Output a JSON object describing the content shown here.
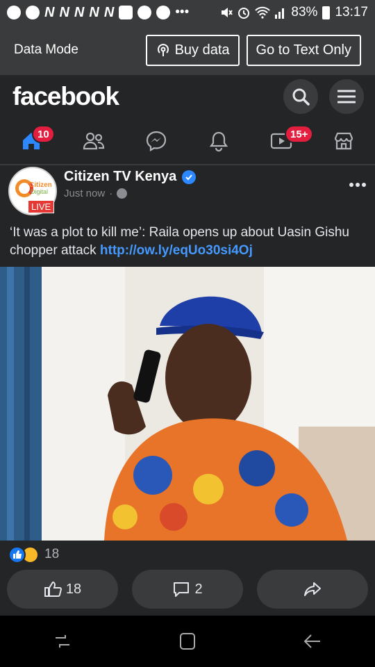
{
  "status_bar": {
    "icons": [
      "whatsapp-icon",
      "facebook-icon",
      "n-icon",
      "n-icon",
      "n-icon",
      "n-icon",
      "n-icon",
      "linkedin-icon",
      "app-icon",
      "app-icon",
      "more-icon",
      "mute-icon",
      "alarm-icon",
      "wifi-icon",
      "signal-icon",
      "battery-icon"
    ],
    "n_letter": "N",
    "more": "•••",
    "battery": "83%",
    "time": "13:17"
  },
  "data_mode": {
    "label": "Data Mode",
    "buy_data": "Buy data",
    "text_only": "Go to Text Only"
  },
  "header": {
    "logo": "facebook"
  },
  "nav": {
    "home_badge": "10",
    "video_badge": "15+"
  },
  "post": {
    "page_name": "Citizen TV Kenya",
    "avatar_line1": "Citizen",
    "avatar_line2": "Digital",
    "live": "LIVE",
    "time": "Just now",
    "separator": "·",
    "text": "‘It was a plot to kill me’: Raila opens up about Uasin Gishu chopper attack ",
    "link": "http://ow.ly/eqUo30si4Oj",
    "reaction_count": "18",
    "like_count": "18",
    "comment_count": "2"
  },
  "colors": {
    "bg": "#242527",
    "surface": "#3a3b3c",
    "accent": "#2d88ff",
    "badge": "#e41e3f",
    "link": "#4599ff"
  }
}
